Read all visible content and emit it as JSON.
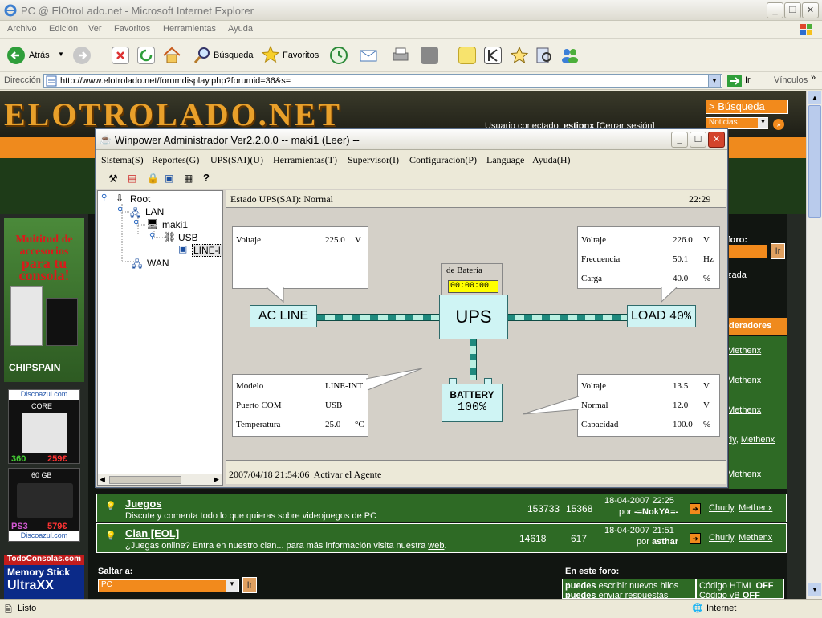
{
  "ie": {
    "title": "PC @ ElOtroLado.net - Microsoft Internet Explorer",
    "menu": [
      "Archivo",
      "Edición",
      "Ver",
      "Favoritos",
      "Herramientas",
      "Ayuda"
    ],
    "toolbar": {
      "back": "Atrás",
      "search": "Búsqueda",
      "favorites": "Favoritos"
    },
    "address_label": "Dirección",
    "url": "http://www.elotrolado.net/forumdisplay.php?forumid=36&s=",
    "go": "Ir",
    "links": "Vínculos",
    "status_left": "Listo",
    "status_zone": "Internet"
  },
  "site": {
    "logo": "ELOTROLADO.NET",
    "user_text": "Usuario conectado: ",
    "user_name": "estipnx",
    "logout": "[Cerrar sesión]",
    "search_btn": "> Búsqueda",
    "news_select": "Noticias",
    "ad_line1": "Muititud de",
    "ad_line2": "accesorios",
    "ad_line3": "para tu",
    "ad_line4": "consola!",
    "ad_brand": "CHIPSPAIN",
    "ad2_site": "Discoazul.com",
    "ad2_core": "CORE",
    "ad2_model": "360",
    "ad2_price": "259€",
    "ad3_gb": "60 GB",
    "ad3_model": "PS3",
    "ad3_price": "579€",
    "ad3_site": "Discoazul.com",
    "ad4_site": "TodoConsolas.com",
    "ad4_l1": "Memory Stick",
    "ad4_l2": "UltraXX",
    "foro_label": "foro:",
    "foro_go": "Ir",
    "avanzada": "zada",
    "moderadores": "deradores",
    "mods": [
      "Methenx",
      "Methenx",
      "Methenx",
      "Methenx",
      "Methenx"
    ],
    "mod_prefix": "rly",
    "rows": [
      {
        "title": "Juegos",
        "desc": "Discute y comenta todo lo que quieras sobre videojuegos de PC",
        "threads": "153733",
        "posts": "15368",
        "date": "18-04-2007 22:25",
        "by_prefix": "por ",
        "by": "-=NokYA=-",
        "m1": "Churly",
        "m2": "Methenx"
      },
      {
        "title": "Clan [EOL]",
        "desc": "¿Juegas online? Entra en nuestro clan... para más información visita nuestra ",
        "desc_link": "web",
        "desc_end": ".",
        "threads": "14618",
        "posts": "617",
        "date": "18-04-2007 21:51",
        "by_prefix": "por ",
        "by": "asthar",
        "m1": "Churly",
        "m2": "Methenx"
      }
    ],
    "jump_label": "Saltar a:",
    "jump_value": "PC",
    "jump_go": "Ir",
    "this_forum": "En este foro:",
    "perm1": "puedes",
    "perm1_text": " escribir nuevos hilos",
    "perm2": "puedes",
    "perm2_text": " enviar respuestas",
    "html_code": "Código HTML ",
    "html_off": "OFF",
    "vb_code": "Código vB ",
    "vb_off": "OFF"
  },
  "winpower": {
    "title": "Winpower Administrador Ver2.2.0.0 -- maki1 (Leer) --",
    "menu": [
      "Sistema(S)",
      "Reportes(G)",
      "UPS(SAI)(U)",
      "Herramientas(T)",
      "Supervisor(I)",
      "Configuración(P)",
      "Language",
      "Ayuda(H)"
    ],
    "tree": {
      "root": "Root",
      "lan": "LAN",
      "host": "maki1",
      "usb": "USB",
      "device": "LINE-INT",
      "wan": "WAN"
    },
    "status_label": "Estado UPS(SAI): ",
    "status_value": "Normal",
    "time": "22:29",
    "input": {
      "label": "Voltaje",
      "value": "225.0",
      "unit": "V"
    },
    "battery_time": {
      "label": "de Batería",
      "value": "00:00:00"
    },
    "output": [
      {
        "label": "Voltaje",
        "value": "226.0",
        "unit": "V"
      },
      {
        "label": "Frecuencia",
        "value": "50.1",
        "unit": "Hz"
      },
      {
        "label": "Carga",
        "value": "40.0",
        "unit": "%"
      }
    ],
    "ac_line": "AC LINE",
    "ups": "UPS",
    "load_label": "LOAD",
    "load_value": "40%",
    "battery_label": "BATTERY",
    "battery_value": "100%",
    "info": [
      {
        "label": "Modelo",
        "value": "LINE-INT",
        "unit": ""
      },
      {
        "label": "Puerto COM",
        "value": "USB",
        "unit": ""
      },
      {
        "label": "Temperatura",
        "value": "25.0",
        "unit": "°C"
      }
    ],
    "battery": [
      {
        "label": "Voltaje",
        "value": "13.5",
        "unit": "V"
      },
      {
        "label": "Normal",
        "value": "12.0",
        "unit": "V"
      },
      {
        "label": "Capacidad",
        "value": "100.0",
        "unit": "%"
      }
    ],
    "log_time": "2007/04/18 21:54:06",
    "log_msg": "Activar el Agente"
  }
}
